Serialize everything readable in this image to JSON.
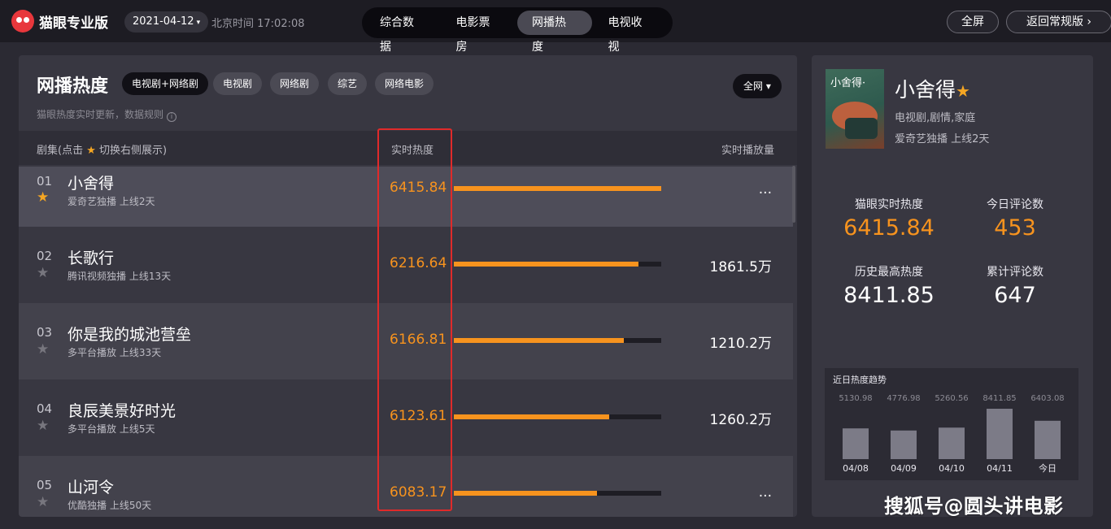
{
  "topbar": {
    "logo_text": "猫眼专业版",
    "date": "2021-04-12",
    "clock": "北京时间 17:02:08",
    "nav_tabs": [
      "综合数据",
      "电影票房",
      "网播热度",
      "电视收视"
    ],
    "active_tab": "网播热度",
    "fullscreen": "全屏",
    "back": "返回常规版"
  },
  "main": {
    "title": "网播热度",
    "chips": [
      "电视剧+网络剧",
      "电视剧",
      "网络剧",
      "综艺",
      "网络电影"
    ],
    "region": "全网",
    "subnote": "猫眼热度实时更新，数据规则",
    "headers": {
      "col1_prefix": "剧集(点击",
      "col1_suffix": "切换右侧展示)",
      "col2": "实时热度",
      "col3": "实时播放量"
    },
    "rows": [
      {
        "rank": "01",
        "name": "小舍得",
        "meta": "爱奇艺独播  上线2天",
        "heat": "6415.84",
        "heat_value": 6415.84,
        "plays": "...",
        "starred": true
      },
      {
        "rank": "02",
        "name": "长歌行",
        "meta": "腾讯视频独播  上线13天",
        "heat": "6216.64",
        "heat_value": 6216.64,
        "plays": "1861.5万",
        "starred": false
      },
      {
        "rank": "03",
        "name": "你是我的城池营垒",
        "meta": "多平台播放  上线33天",
        "heat": "6166.81",
        "heat_value": 6166.81,
        "plays": "1210.2万",
        "starred": false
      },
      {
        "rank": "04",
        "name": "良辰美景好时光",
        "meta": "多平台播放  上线5天",
        "heat": "6123.61",
        "heat_value": 6123.61,
        "plays": "1260.2万",
        "starred": false
      },
      {
        "rank": "05",
        "name": "山河令",
        "meta": "优酷独播  上线50天",
        "heat": "6083.17",
        "heat_value": 6083.17,
        "plays": "...",
        "starred": false
      }
    ],
    "bar_fill_fractions": [
      1.0,
      0.89,
      0.82,
      0.75,
      0.69
    ]
  },
  "detail": {
    "poster_text": "小舍得·",
    "name": "小舍得",
    "genre": "电视剧,剧情,家庭",
    "platform": "爱奇艺独播  上线2天",
    "stats": {
      "realtime_label": "猫眼实时热度",
      "realtime": "6415.84",
      "comments_today_label": "今日评论数",
      "comments_today": "453",
      "history_max_label": "历史最高热度",
      "history_max": "8411.85",
      "comments_total_label": "累计评论数",
      "comments_total": "647"
    },
    "trend_title": "近日热度趋势"
  },
  "chart_data": {
    "type": "bar",
    "title": "近日热度趋势",
    "categories": [
      "04/08",
      "04/09",
      "04/10",
      "04/11",
      "今日"
    ],
    "values": [
      5130.98,
      4776.98,
      5260.56,
      8411.85,
      6403.08
    ],
    "value_labels": [
      "5130.98",
      "4776.98",
      "5260.56",
      "8411.85",
      "6403.08"
    ]
  },
  "watermark": "搜狐号@圆头讲电影",
  "colors": {
    "accent": "#f7931e",
    "star": "#f5a623",
    "highlight_box": "#e02a2a"
  }
}
